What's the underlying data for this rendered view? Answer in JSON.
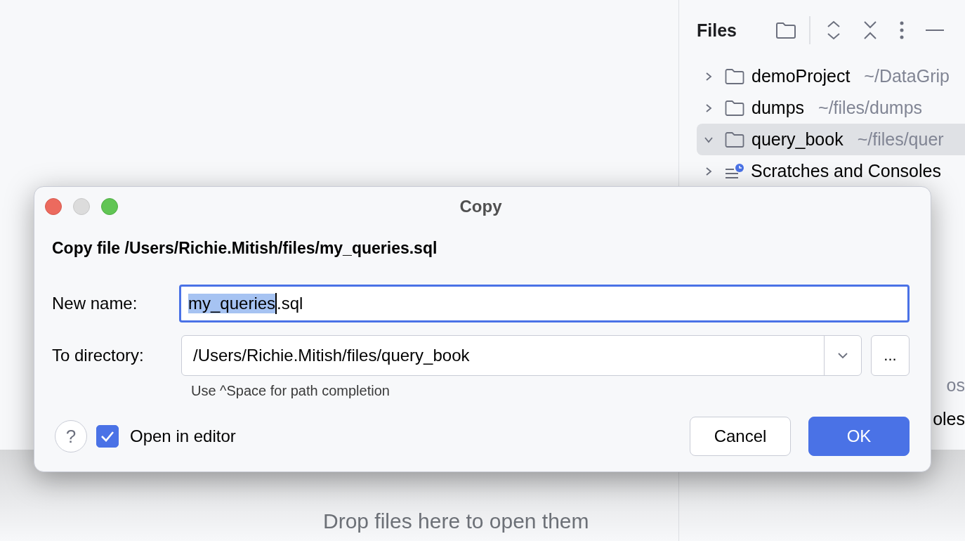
{
  "editor_area": {
    "hints": [
      "Drop files here to open them"
    ]
  },
  "files_panel": {
    "title": "Files",
    "tree": [
      {
        "name": "demoProject",
        "path": "~/DataGrip",
        "kind": "folder",
        "expanded": false,
        "selected": false
      },
      {
        "name": "dumps",
        "path": "~/files/dumps",
        "kind": "folder",
        "expanded": false,
        "selected": false
      },
      {
        "name": "query_book",
        "path": "~/files/quer",
        "kind": "folder",
        "expanded": true,
        "selected": true
      },
      {
        "name": "Scratches and Consoles",
        "kind": "scratches",
        "expanded": false,
        "selected": false
      }
    ],
    "hidden_fragments": [
      "os",
      "oles"
    ]
  },
  "dialog": {
    "title": "Copy",
    "heading": "Copy file /Users/Richie.Mitish/files/my_queries.sql",
    "new_name": {
      "label": "New name:",
      "value_selected": "my_queries",
      "value_rest": ".sql"
    },
    "to_directory": {
      "label": "To directory:",
      "value": "/Users/Richie.Mitish/files/query_book",
      "browse": "...",
      "hint": "Use ^Space for path completion"
    },
    "help": "?",
    "open_in_editor": {
      "label": "Open in editor",
      "checked": true
    },
    "buttons": [
      {
        "label": "Cancel",
        "kind": "secondary"
      },
      {
        "label": "OK",
        "kind": "primary"
      }
    ]
  }
}
